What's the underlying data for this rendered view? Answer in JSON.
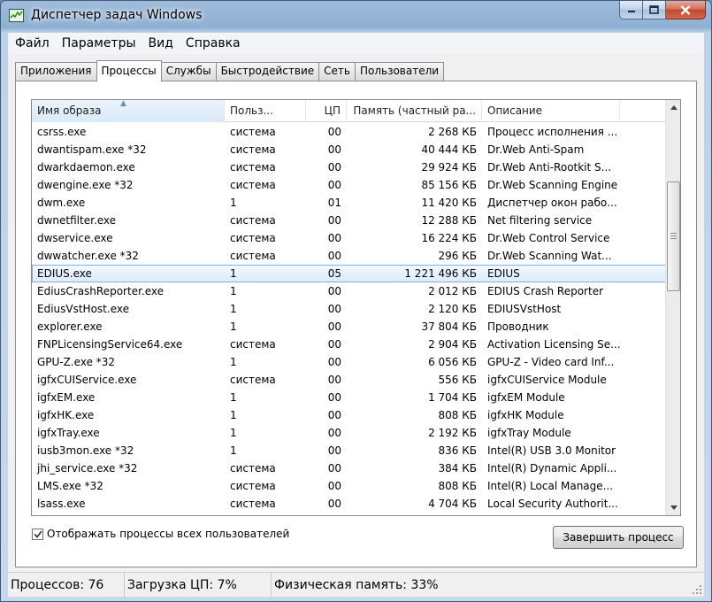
{
  "window": {
    "title": "Диспетчер задач Windows",
    "icon": "task-manager-icon"
  },
  "menu": [
    "Файл",
    "Параметры",
    "Вид",
    "Справка"
  ],
  "tabs": [
    {
      "label": "Приложения",
      "active": false
    },
    {
      "label": "Процессы",
      "active": true
    },
    {
      "label": "Службы",
      "active": false
    },
    {
      "label": "Быстродействие",
      "active": false
    },
    {
      "label": "Сеть",
      "active": false
    },
    {
      "label": "Пользователи",
      "active": false
    }
  ],
  "table": {
    "columns": [
      "Имя образа",
      "Польз...",
      "ЦП",
      "Память (частный ра...",
      "Описание"
    ],
    "sorted_column": "Имя образа",
    "rows": [
      [
        "csrss.exe",
        "система",
        "00",
        "2 268 КБ",
        "Процесс исполнения ..."
      ],
      [
        "dwantispam.exe *32",
        "система",
        "00",
        "40 444 КБ",
        "Dr.Web Anti-Spam"
      ],
      [
        "dwarkdaemon.exe",
        "система",
        "00",
        "29 924 КБ",
        "Dr.Web Anti-Rootkit S..."
      ],
      [
        "dwengine.exe *32",
        "система",
        "00",
        "85 156 КБ",
        "Dr.Web Scanning Engine"
      ],
      [
        "dwm.exe",
        "1",
        "01",
        "11 420 КБ",
        "Диспетчер окон рабо..."
      ],
      [
        "dwnetfilter.exe",
        "система",
        "00",
        "12 288 КБ",
        "Net filtering service"
      ],
      [
        "dwservice.exe",
        "система",
        "00",
        "16 224 КБ",
        "Dr.Web Control Service"
      ],
      [
        "dwwatcher.exe *32",
        "система",
        "00",
        "296 КБ",
        "Dr.Web Scanning Wat..."
      ],
      [
        "EDIUS.exe",
        "1",
        "05",
        "1 221 496 КБ",
        "EDIUS"
      ],
      [
        "EdiusCrashReporter.exe",
        "1",
        "00",
        "2 012 КБ",
        "EDIUS Crash Reporter"
      ],
      [
        "EdiusVstHost.exe",
        "1",
        "00",
        "2 120 КБ",
        "EDIUSVstHost"
      ],
      [
        "explorer.exe",
        "1",
        "00",
        "37 804 КБ",
        "Проводник"
      ],
      [
        "FNPLicensingService64.exe",
        "система",
        "00",
        "2 904 КБ",
        "Activation Licensing Se..."
      ],
      [
        "GPU-Z.exe *32",
        "1",
        "00",
        "6 056 КБ",
        "GPU-Z - Video card Inf..."
      ],
      [
        "igfxCUIService.exe",
        "система",
        "00",
        "556 КБ",
        "igfxCUIService Module"
      ],
      [
        "igfxEM.exe",
        "1",
        "00",
        "1 704 КБ",
        "igfxEM Module"
      ],
      [
        "igfxHK.exe",
        "1",
        "00",
        "808 КБ",
        "igfxHK Module"
      ],
      [
        "igfxTray.exe",
        "1",
        "00",
        "2 192 КБ",
        "igfxTray Module"
      ],
      [
        "iusb3mon.exe *32",
        "1",
        "00",
        "836 КБ",
        "Intel(R) USB 3.0 Monitor"
      ],
      [
        "jhi_service.exe *32",
        "система",
        "00",
        "384 КБ",
        "Intel(R) Dynamic Appli..."
      ],
      [
        "LMS.exe *32",
        "система",
        "00",
        "808 КБ",
        "Intel(R) Local Manage..."
      ],
      [
        "lsass.exe",
        "система",
        "00",
        "4 704 КБ",
        "Local Security Authorit..."
      ]
    ],
    "selected_row": 8
  },
  "show_all_users": {
    "label": "Отображать процессы всех пользователей",
    "checked": true
  },
  "end_process_button": "Завершить процесс",
  "status": {
    "processes": "Процессов: 76",
    "cpu": "Загрузка ЦП: 7%",
    "memory": "Физическая память: 33%"
  }
}
